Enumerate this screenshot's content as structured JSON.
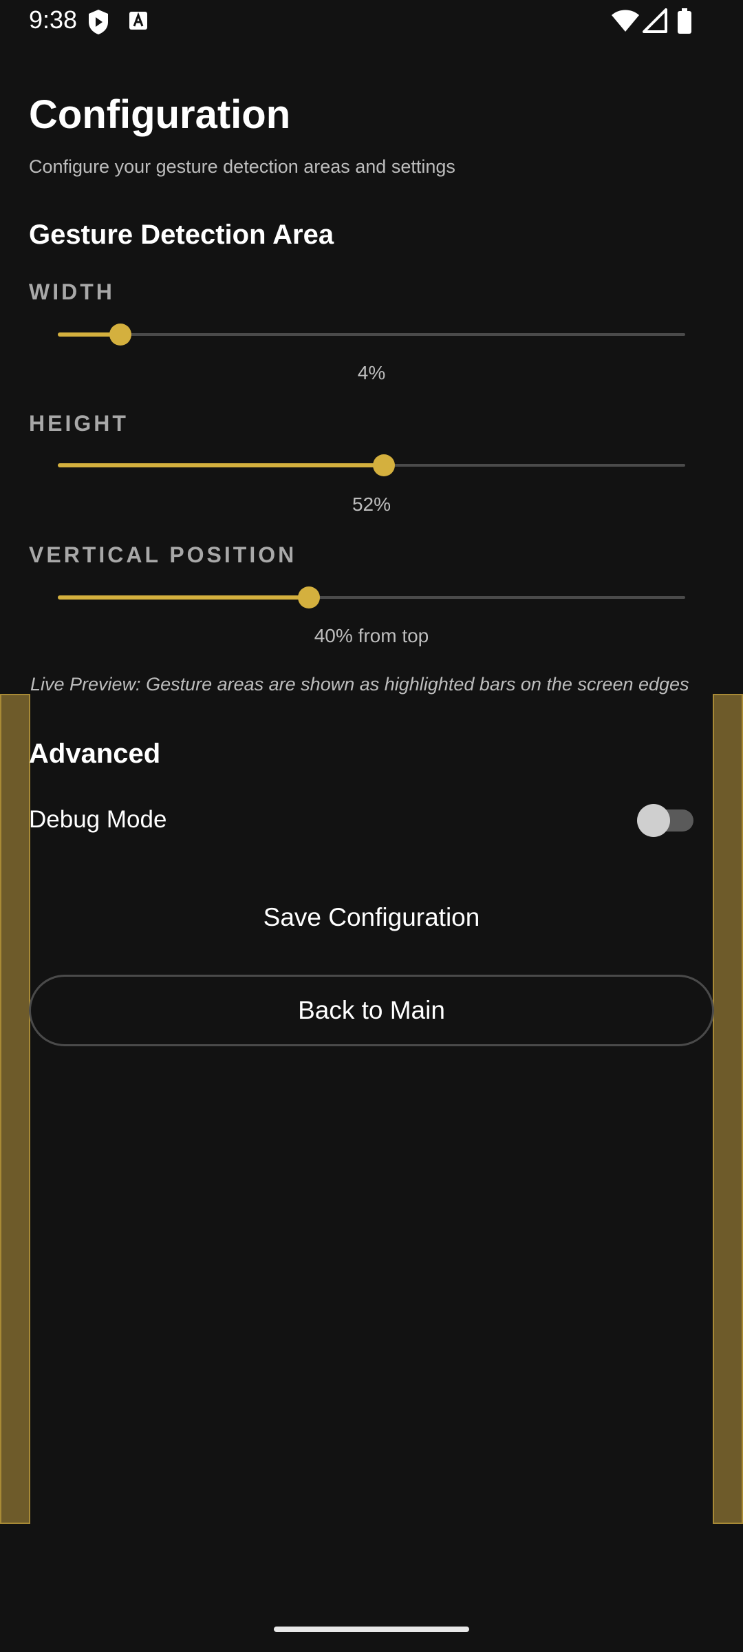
{
  "status_bar": {
    "time": "9:38",
    "icons": [
      "shield-icon",
      "a-icon",
      "wifi-icon",
      "signal-icon",
      "battery-icon"
    ]
  },
  "header": {
    "title": "Configuration",
    "subtitle": "Configure your gesture detection areas and settings"
  },
  "gesture_section": {
    "title": "Gesture Detection Area",
    "sliders": [
      {
        "label": "WIDTH",
        "value_text": "4%",
        "fraction": 0.1
      },
      {
        "label": "HEIGHT",
        "value_text": "52%",
        "fraction": 0.52
      },
      {
        "label": "VERTICAL POSITION",
        "value_text": "40% from top",
        "fraction": 0.4
      }
    ],
    "preview_note": "Live Preview: Gesture areas are shown as highlighted bars on the screen edges"
  },
  "advanced": {
    "title": "Advanced",
    "debug_label": "Debug Mode",
    "debug_enabled": false
  },
  "buttons": {
    "save": "Save Configuration",
    "back": "Back to Main"
  },
  "colors": {
    "background": "#121212",
    "accent": "#d4b03e",
    "edge_preview": "#6e5b2a"
  }
}
